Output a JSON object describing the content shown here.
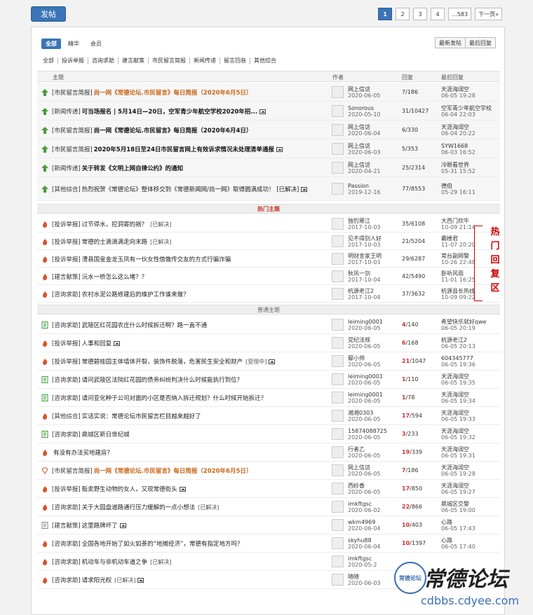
{
  "toolbar": {
    "post_label": "发帖"
  },
  "pager": {
    "pages": [
      "1",
      "2",
      "3",
      "4",
      "...583"
    ],
    "next_label": "下一页»",
    "current": "1"
  },
  "tabs": [
    "全部",
    "精华",
    "会员"
  ],
  "sort_buttons": [
    "最新发帖",
    "最后回复"
  ],
  "categories": [
    "全部",
    "投诉举报",
    "咨询求助",
    "建言献策",
    "市民留言简报",
    "新闻传递",
    "留言回音",
    "其他综合"
  ],
  "columns": {
    "topic": "主题",
    "author": "作者",
    "replies": "回复",
    "last": "最后回复"
  },
  "sticky_rows": [
    {
      "prefix": "[市民留言简报]",
      "title": "尚一网《常德论坛.市民留言》每日简报（2020年6月5日）",
      "style": "hl",
      "author": "网上信访",
      "date": "2020-06-05",
      "replies": "7/186",
      "last_user": "天涯海阔空",
      "last_time": "06-05 19:28"
    },
    {
      "prefix": "[新闻传递]",
      "title": "可当场报名 | 5月14日—20日，空军青少年航空学校2020年招...",
      "style": "bd",
      "img": true,
      "author": "Sonorous",
      "date": "2020-05-10",
      "replies": "31/10427",
      "last_user": "空军青少年航空学校",
      "last_time": "06-04 22:03"
    },
    {
      "prefix": "[市民留言简报]",
      "title": "尚一网《常德论坛.市民留言》每日简报（2020年6月4日）",
      "style": "bd",
      "author": "网上信访",
      "date": "2020-06-04",
      "replies": "6/330",
      "last_user": "天涯海阔空",
      "last_time": "06-04 20:22"
    },
    {
      "prefix": "[市民留言简报]",
      "title": "2020年5月18日至24日市民留言网上有效诉求情况未处理清单通报",
      "style": "bd",
      "img": true,
      "author": "网上信访",
      "date": "2020-06-03",
      "replies": "5/353",
      "last_user": "SYW1668",
      "last_time": "06-03 16:52"
    },
    {
      "prefix": "[新闻传递]",
      "title": "关于转发《文明上网自律公约》的通知",
      "style": "bd",
      "author": "网上信访",
      "date": "2020-04-21",
      "replies": "25/2314",
      "last_user": "冷眼看世界",
      "last_time": "05-31 15:52"
    },
    {
      "prefix": "[其他综合]",
      "title": "热烈祝贺《常德论坛》整体移交到《常德新闻网/尚一网》取得圆满成功！ [已解决]",
      "style": "",
      "img": true,
      "author": "Passion",
      "date": "2019-12-16",
      "replies": "77/8553",
      "last_user": "德伯",
      "last_time": "05-29 16:11"
    }
  ],
  "hot_section": "热门主题",
  "hot_rows": [
    {
      "prefix": "[投诉举报]",
      "title": "过节停水，挖洞寄的祸？",
      "solved": "[已解决]",
      "author": "独钓寒江",
      "date": "2017-10-03",
      "replies": "35/6108",
      "last_user": "大西门欣牛",
      "last_time": "10-09 21:14"
    },
    {
      "prefix": "[投诉举报]",
      "title": "常德的士滴滴满走向末路",
      "solved": "[已解决]",
      "author": "见不得别人好",
      "date": "2017-10-03",
      "replies": "21/5204",
      "last_user": "霸楼君",
      "last_time": "11-07 20:20"
    },
    {
      "prefix": "[投诉举报]",
      "title": "澧县国皇金龙玉凤有一伙女性借做传交友的方式行骗诈骗",
      "solved": "",
      "author": "明财金家王明",
      "date": "2017-10-03",
      "replies": "29/6287",
      "last_user": "常台副网警",
      "last_time": "10-26 22:48"
    },
    {
      "prefix": "[建言献策]",
      "title": "沅水一桥怎么这么堵？？",
      "solved": "",
      "author": "秋风一剑",
      "date": "2017-10-04",
      "replies": "42/5490",
      "last_user": "卧听风雨",
      "last_time": "11-01 16:25"
    },
    {
      "prefix": "[咨询求助]",
      "title": "农村水泥公路修建后的维护工作谁来做？",
      "solved": "",
      "author": "杭源老江2",
      "date": "2017-10-04",
      "replies": "37/3632",
      "last_user": "杭源县长热线",
      "last_time": "10-09 09:22"
    }
  ],
  "hot_note": "热门回复区",
  "normal_section": "普通主题",
  "normal_rows": [
    {
      "prefix": "[咨询求助]",
      "title": "武陵区红花园农庄什么时候拆迁啊？路一直不通",
      "icon": "doc",
      "author": "leiming0001",
      "date": "2020-06-05",
      "r": "4",
      "v": "/140",
      "last_user": "希望快乐就好qwe",
      "last_time": "06-05 20:19"
    },
    {
      "prefix": "[投诉举报]",
      "title": "人事和回复",
      "icon": "fire",
      "img": true,
      "author": "党纪法规",
      "date": "2020-06-05",
      "r": "6",
      "v": "/168",
      "last_user": "杭源老江2",
      "last_time": "06-05 20:13"
    },
    {
      "prefix": "[投诉举报]",
      "title": "常德碧桂园主体墙体开裂，装饰件脱落，危害民生安全和财产",
      "icon": "fire",
      "solved": "[受理中]",
      "img": true,
      "author": "鄢小帅",
      "date": "2020-06-05",
      "r": "21",
      "v": "/1047",
      "last_user": "604345777",
      "last_time": "06-05 19:36"
    },
    {
      "prefix": "[咨询求助]",
      "title": "请问武陵区法院红花园的债务纠纷判决什么时候能执行到位？",
      "icon": "doc",
      "author": "leiming0001",
      "date": "2020-06-05",
      "r": "1",
      "v": "/110",
      "last_user": "天涯海阔空",
      "last_time": "06-05 19:35"
    },
    {
      "prefix": "[咨询求助]",
      "title": "请问亚化种子公司对面的小区是否纳入拆迁规划？什么时候开始拆迁？",
      "icon": "doc",
      "author": "leiming0001",
      "date": "2020-06-05",
      "r": "1",
      "v": "/78",
      "last_user": "天涯海阔空",
      "last_time": "06-05 19:34"
    },
    {
      "prefix": "[其他综合]",
      "title": "实话实说：常德论坛市民留言栏目越来越好了",
      "icon": "fire",
      "author": "湘湘0303",
      "date": "2020-06-05",
      "r": "17",
      "v": "/594",
      "last_user": "天涯海阔空",
      "last_time": "06-05 19:33"
    },
    {
      "prefix": "[咨询求助]",
      "title": "鼎城区新日世纪城",
      "icon": "doc",
      "author": "15874088725",
      "date": "2020-06-05",
      "r": "3",
      "v": "/233",
      "last_user": "天涯海阔空",
      "last_time": "06-05 19:32"
    },
    {
      "prefix": "",
      "title": "有没有办法买地建房？",
      "icon": "fire",
      "author": "行者乙",
      "date": "2020-06-05",
      "r": "19",
      "v": "/339",
      "last_user": "天涯海阔空",
      "last_time": "06-05 19:31"
    },
    {
      "prefix": "[市民留言简报]",
      "title": "尚一网《常德论坛.市民留言》每日简报（2020年6月5日）",
      "icon": "gem",
      "style": "hl",
      "author": "网上信访",
      "date": "2020-06-05",
      "r": "7",
      "v": "/186",
      "last_user": "天涯海阔空",
      "last_time": "06-05 19:28"
    },
    {
      "prefix": "[投诉举报]",
      "title": "贩卖野生动物的女人，又现常德街头",
      "icon": "fire",
      "img": true,
      "author": "西岭香",
      "date": "2020-06-05",
      "r": "17",
      "v": "/850",
      "last_user": "天涯海阔空",
      "last_time": "06-05 19:27"
    },
    {
      "prefix": "[咨询求助]",
      "title": "关于大园盘道路通行压力缓解的一点小想法",
      "icon": "fire",
      "solved": "[已解决]",
      "author": "imkftgsc",
      "date": "2020-06-02",
      "r": "22",
      "v": "/866",
      "last_user": "鼎城区交警",
      "last_time": "06-05 19:00"
    },
    {
      "prefix": "[建言献策]",
      "title": "这里路牌坏了",
      "icon": "doc2",
      "img": true,
      "author": "wkm4969",
      "date": "2020-06-04",
      "r": "10",
      "v": "/403",
      "last_user": "心路",
      "last_time": "06-05 17:43"
    },
    {
      "prefix": "[咨询求助]",
      "title": "全国各地开始了如火如荼的“地摊经济”，常德有指定地方吗？",
      "icon": "fire",
      "author": "skyhu88",
      "date": "2020-06-04",
      "r": "10",
      "v": "/1397",
      "last_user": "心路",
      "last_time": "06-05 17:40"
    },
    {
      "prefix": "[咨询求助]",
      "title": "机动车与非机动车道之争",
      "icon": "fire",
      "solved": "[已解决]",
      "author": "imkftgsc",
      "date": "2020-05-2",
      "r": "",
      "v": "",
      "last_user": "",
      "last_time": ""
    },
    {
      "prefix": "[咨询求助]",
      "title": "请求阳光权",
      "icon": "fire",
      "solved": "[已解决]",
      "img": true,
      "author": "随随",
      "date": "2020-06-03",
      "r": "",
      "v": "",
      "last_user": "",
      "last_time": ""
    }
  ],
  "watermark": {
    "badge": "常德论坛",
    "title": "常德论坛",
    "url": "cdbbs.cdyee.com"
  },
  "colors": {
    "accent": "#3b74b6",
    "highlight": "#c8671a",
    "reply_red": "#cc3333",
    "hot_red": "#cc0000"
  }
}
